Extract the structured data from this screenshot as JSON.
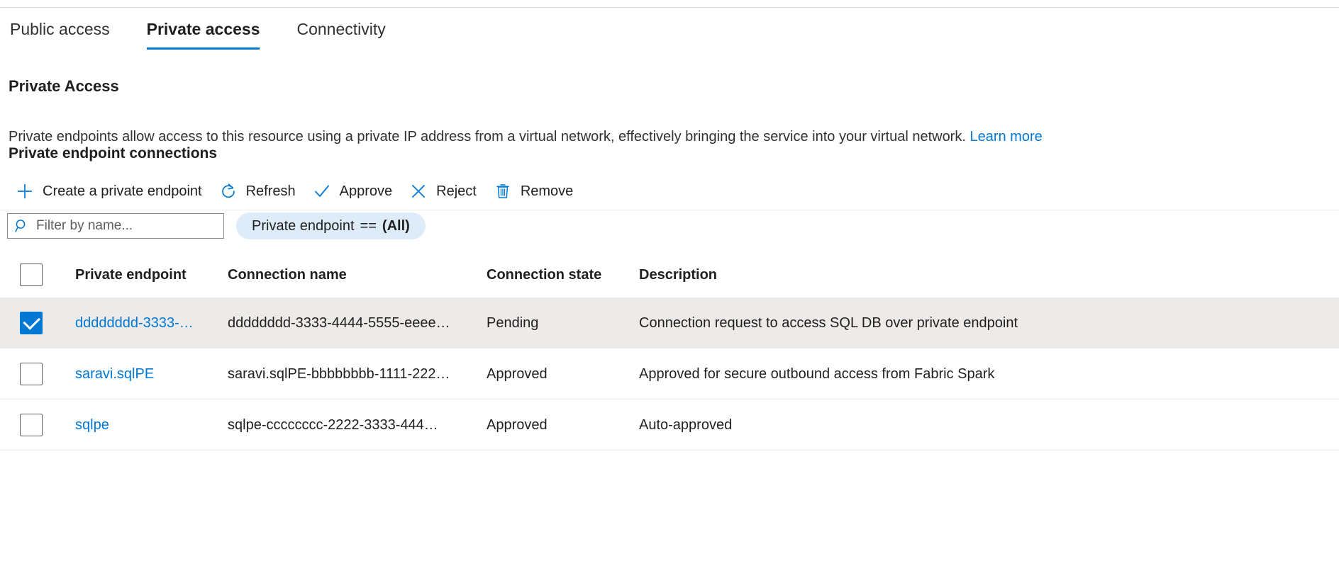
{
  "tabs": [
    {
      "label": "Public access",
      "selected": false
    },
    {
      "label": "Private access",
      "selected": true
    },
    {
      "label": "Connectivity",
      "selected": false
    }
  ],
  "section": {
    "title": "Private Access",
    "description": "Private endpoints allow access to this resource using a private IP address from a virtual network, effectively bringing the service into your virtual network.",
    "learn_more": "Learn more",
    "subtitle": "Private endpoint connections"
  },
  "toolbar": {
    "create_label": "Create a private endpoint",
    "refresh_label": "Refresh",
    "approve_label": "Approve",
    "reject_label": "Reject",
    "remove_label": "Remove"
  },
  "filters": {
    "search_placeholder": "Filter by name...",
    "search_value": "",
    "pill_field": "Private endpoint",
    "pill_operator": "==",
    "pill_value": "(All)"
  },
  "table": {
    "columns": [
      "Private endpoint",
      "Connection name",
      "Connection state",
      "Description"
    ],
    "select_all_checked": false,
    "rows": [
      {
        "checked": true,
        "endpoint": "dddddddd-3333-…",
        "connection_name": "dddddddd-3333-4444-5555-eeee…",
        "state": "Pending",
        "description": "Connection request to access SQL DB over private endpoint"
      },
      {
        "checked": false,
        "endpoint": "saravi.sqlPE",
        "connection_name": "saravi.sqlPE-bbbbbbbb-1111-222…",
        "state": "Approved",
        "description": "Approved for secure outbound access from Fabric Spark"
      },
      {
        "checked": false,
        "endpoint": "sqlpe",
        "connection_name": "sqlpe-cccccccc-2222-3333-444…",
        "state": "Approved",
        "description": "Auto-approved"
      }
    ]
  },
  "colors": {
    "accent": "#0078d4",
    "selected_row": "#edebe9",
    "pill_bg": "#deecf9"
  }
}
